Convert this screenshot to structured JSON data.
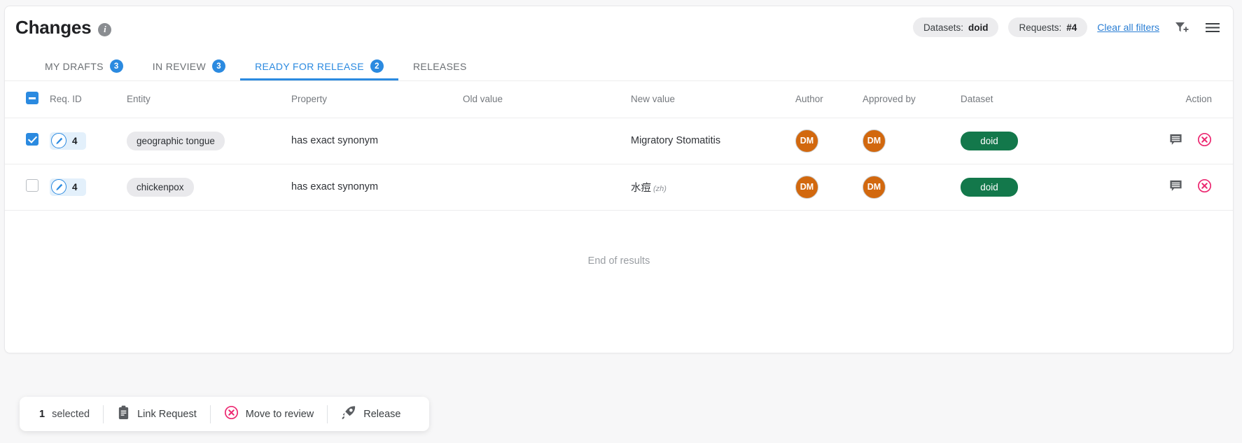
{
  "header": {
    "title": "Changes",
    "info_icon": "info-icon",
    "chips": [
      {
        "label": "Datasets:",
        "value": "doid"
      },
      {
        "label": "Requests:",
        "value": "#4"
      }
    ],
    "clear_all_filters": "Clear all filters",
    "filter_add_icon": "filter-add-icon",
    "menu_icon": "hamburger-menu-icon"
  },
  "tabs": [
    {
      "label": "MY DRAFTS",
      "count": "3",
      "active": false
    },
    {
      "label": "IN REVIEW",
      "count": "3",
      "active": false
    },
    {
      "label": "READY FOR RELEASE",
      "count": "2",
      "active": true
    },
    {
      "label": "RELEASES",
      "count": "",
      "active": false
    }
  ],
  "table": {
    "columns": {
      "req_id": "Req. ID",
      "entity": "Entity",
      "property": "Property",
      "old_value": "Old value",
      "new_value": "New value",
      "author": "Author",
      "approved_by": "Approved by",
      "dataset": "Dataset",
      "action": "Action"
    },
    "rows": [
      {
        "selected": true,
        "req_id": "4",
        "entity": "geographic tongue",
        "property": "has exact synonym",
        "old_value": "",
        "new_value": "Migratory Stomatitis",
        "new_value_lang": "",
        "author": "DM",
        "approved_by": "DM",
        "dataset": "doid"
      },
      {
        "selected": false,
        "req_id": "4",
        "entity": "chickenpox",
        "property": "has exact synonym",
        "old_value": "",
        "new_value": "水痘",
        "new_value_lang": "(zh)",
        "author": "DM",
        "approved_by": "DM",
        "dataset": "doid"
      }
    ],
    "end_of_results": "End of results"
  },
  "action_bar": {
    "selected_count": "1",
    "selected_label": "selected",
    "link_request": "Link Request",
    "move_to_review": "Move to review",
    "release": "Release"
  },
  "colors": {
    "accent_blue": "#2b8ae0",
    "avatar_orange": "#d2680e",
    "dataset_green": "#13784b",
    "danger_pink": "#ec2a72",
    "link_blue": "#2b7fd4"
  }
}
